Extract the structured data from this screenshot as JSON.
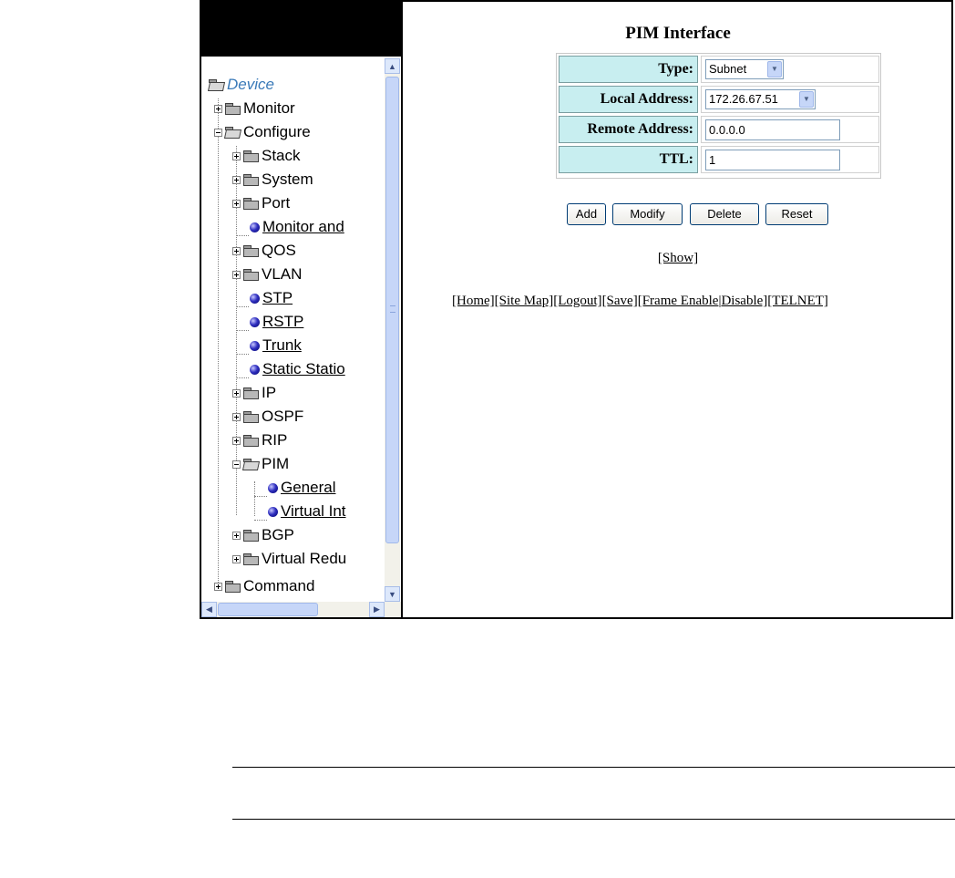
{
  "nav": {
    "tree": [
      {
        "label": "Device",
        "kind": "root"
      },
      {
        "label": "Monitor",
        "kind": "folder"
      },
      {
        "label": "Configure",
        "kind": "folder-open"
      },
      {
        "label": "Stack",
        "kind": "folder"
      },
      {
        "label": "System",
        "kind": "folder"
      },
      {
        "label": "Port",
        "kind": "folder"
      },
      {
        "label": "Monitor and",
        "kind": "link"
      },
      {
        "label": "QOS",
        "kind": "folder"
      },
      {
        "label": "VLAN",
        "kind": "folder"
      },
      {
        "label": "STP",
        "kind": "link"
      },
      {
        "label": "RSTP",
        "kind": "link"
      },
      {
        "label": "Trunk",
        "kind": "link"
      },
      {
        "label": "Static Statio",
        "kind": "link"
      },
      {
        "label": "IP",
        "kind": "folder"
      },
      {
        "label": "OSPF",
        "kind": "folder"
      },
      {
        "label": "RIP",
        "kind": "folder"
      },
      {
        "label": "PIM",
        "kind": "folder-open"
      },
      {
        "label": "General",
        "kind": "link"
      },
      {
        "label": "Virtual Int",
        "kind": "link"
      },
      {
        "label": "BGP",
        "kind": "folder"
      },
      {
        "label": "Virtual Redu",
        "kind": "folder"
      },
      {
        "label": "Command",
        "kind": "folder"
      }
    ]
  },
  "content": {
    "title": "PIM Interface",
    "form": {
      "type_label": "Type:",
      "type_value": "Subnet",
      "local_label": "Local Address:",
      "local_value": "172.26.67.51",
      "remote_label": "Remote Address:",
      "remote_value": "0.0.0.0",
      "ttl_label": "TTL:",
      "ttl_value": "1"
    },
    "buttons": {
      "add": "Add",
      "modify": "Modify",
      "delete": "Delete",
      "reset": "Reset"
    },
    "show_link": "[Show]",
    "links": {
      "home": "[Home]",
      "site_map": "[Site Map]",
      "logout": "[Logout]",
      "save": "[Save]",
      "frame_enable": "[Frame Enable",
      "separator": "|",
      "disable": "Disable]",
      "telnet": "[TELNET]"
    }
  }
}
